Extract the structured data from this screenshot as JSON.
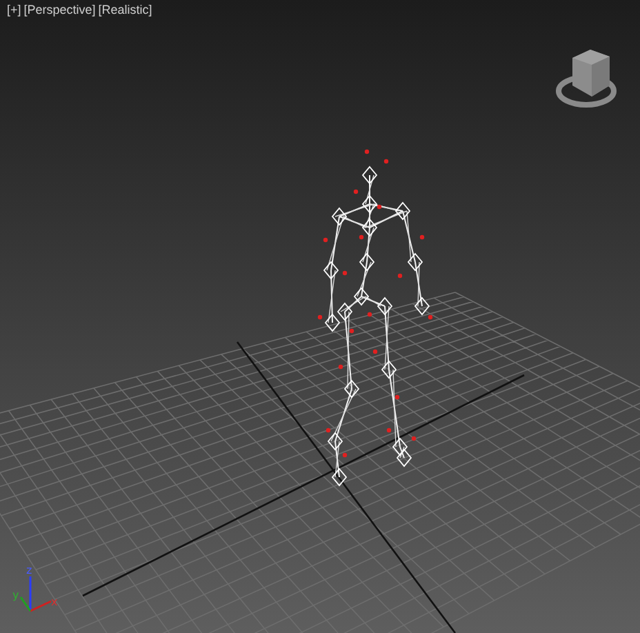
{
  "viewport": {
    "labels": [
      {
        "text": "[+]"
      },
      {
        "text": "[Perspective]"
      },
      {
        "text": "[Realistic]"
      }
    ]
  },
  "axis_gizmo": {
    "x_label": "x",
    "y_label": "y",
    "z_label": "z"
  }
}
